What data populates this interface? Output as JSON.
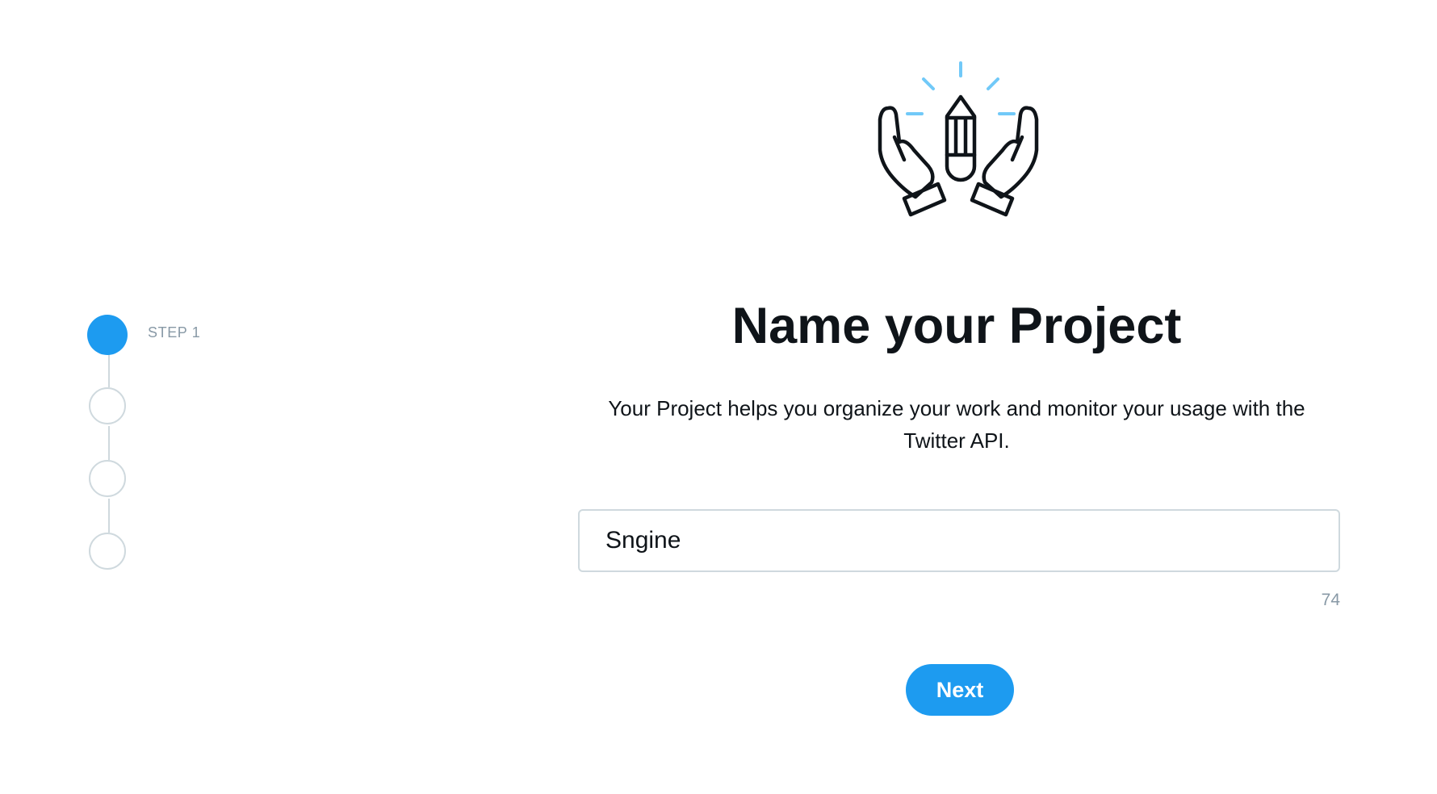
{
  "stepper": {
    "steps": [
      {
        "label": "STEP 1",
        "state": "active"
      },
      {
        "label": "",
        "state": "inactive"
      },
      {
        "label": "",
        "state": "inactive"
      },
      {
        "label": "",
        "state": "inactive"
      }
    ]
  },
  "illustration": {
    "icon": "hands-holding-pencil-icon",
    "colors": {
      "outline": "#0f1419",
      "rays": "#71c9f8"
    }
  },
  "main": {
    "title": "Name your Project",
    "description": "Your Project helps you organize your work and monitor your usage with the Twitter API.",
    "project_name_value": "Sngine",
    "char_counter": "74",
    "next_label": "Next"
  },
  "colors": {
    "accent": "#1d9bf0",
    "border": "#cfd9de",
    "muted_text": "#8899a6",
    "text": "#0f1419"
  }
}
